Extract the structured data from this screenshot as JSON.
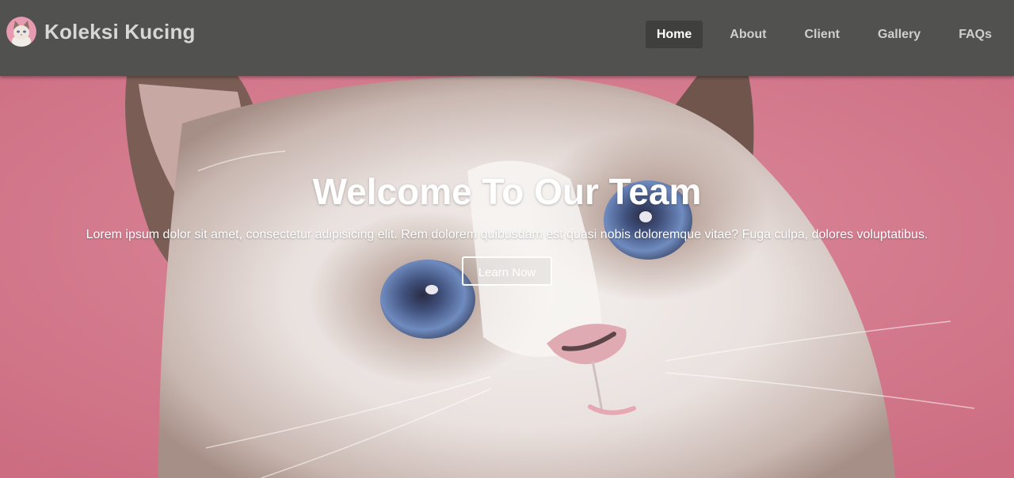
{
  "brand": {
    "name": "Koleksi Kucing",
    "logo_icon": "cat-logo-icon"
  },
  "nav": {
    "items": [
      {
        "label": "Home",
        "active": true
      },
      {
        "label": "About",
        "active": false
      },
      {
        "label": "Client",
        "active": false
      },
      {
        "label": "Gallery",
        "active": false
      },
      {
        "label": "FAQs",
        "active": false
      }
    ]
  },
  "hero": {
    "title": "Welcome To Our Team",
    "text": "Lorem ipsum dolor sit amet, consectetur adipisicing elit. Rem dolorem quibusdam est quasi nobis doloremque vitae? Fuga culpa, dolores voluptatibus.",
    "button_label": "Learn Now",
    "background": "kitten-photo"
  },
  "colors": {
    "navbar": "#515150",
    "active_nav": "#3f3f3e",
    "hero_background": "#d47a8d",
    "text_light": "#ffffff"
  }
}
